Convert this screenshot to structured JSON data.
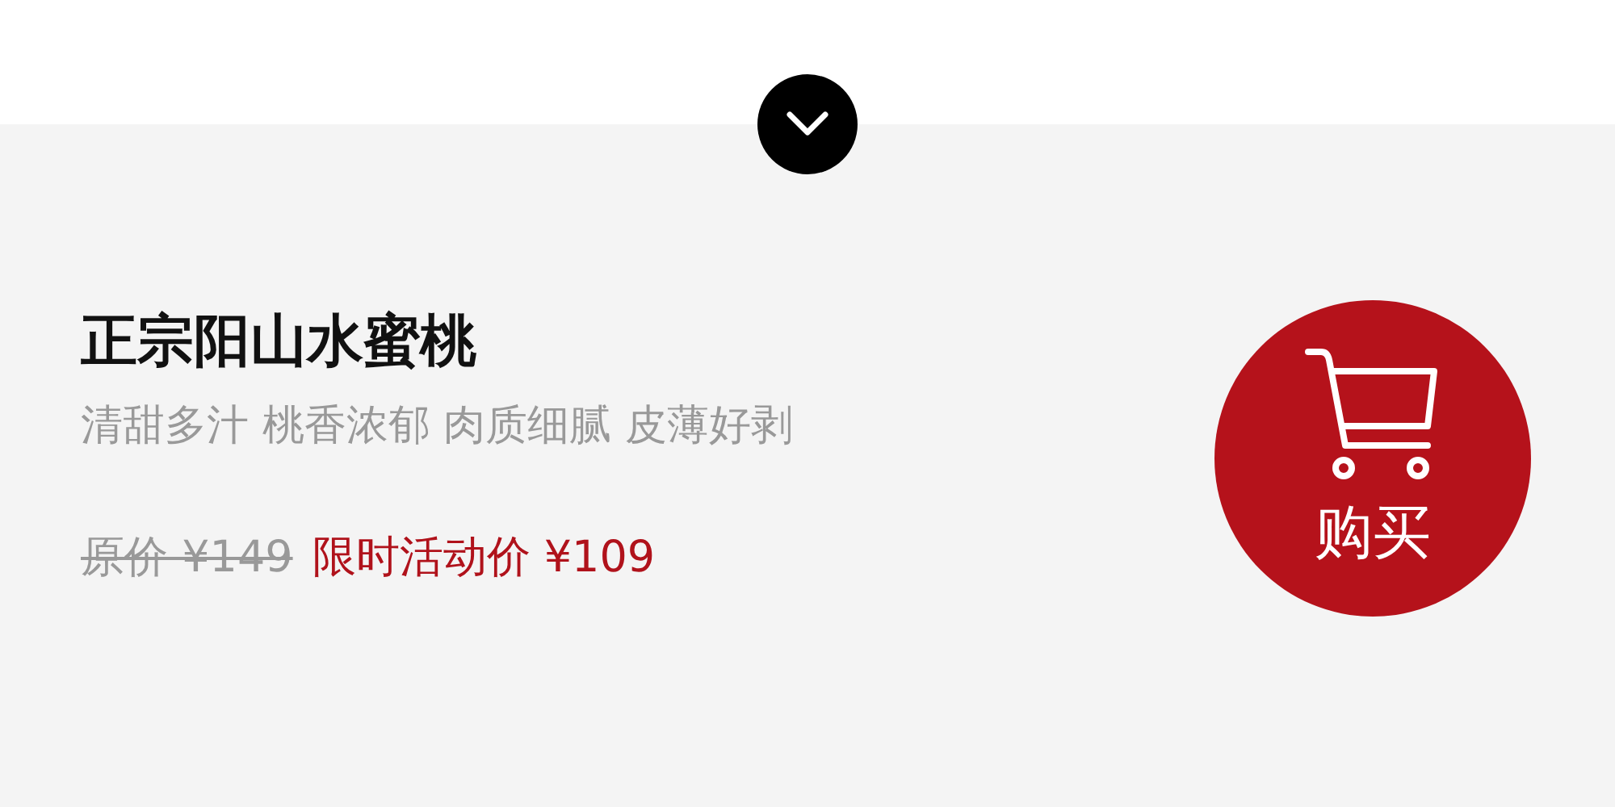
{
  "product": {
    "title": "正宗阳山水蜜桃",
    "tagline": "清甜多汁 桃香浓郁 肉质细腻 皮薄好剥",
    "original_price": "原价 ¥149",
    "sale_price": "限时活动价 ¥109"
  },
  "buy_button": {
    "label": "购买"
  }
}
